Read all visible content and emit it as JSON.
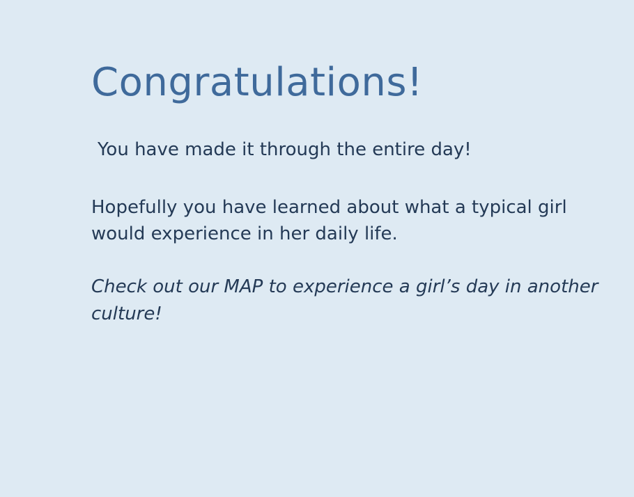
{
  "heading": "Congratulations!",
  "message": {
    "line1": "You have made it through the entire day!",
    "para2": "Hopefully you have learned about what a typical girl would experience in her daily life.",
    "para3": "Check out our MAP to experience a girl’s day in another culture!"
  },
  "colors": {
    "background": "#deeaf3",
    "heading": "#3f6a9b",
    "body_text": "#243a56"
  }
}
